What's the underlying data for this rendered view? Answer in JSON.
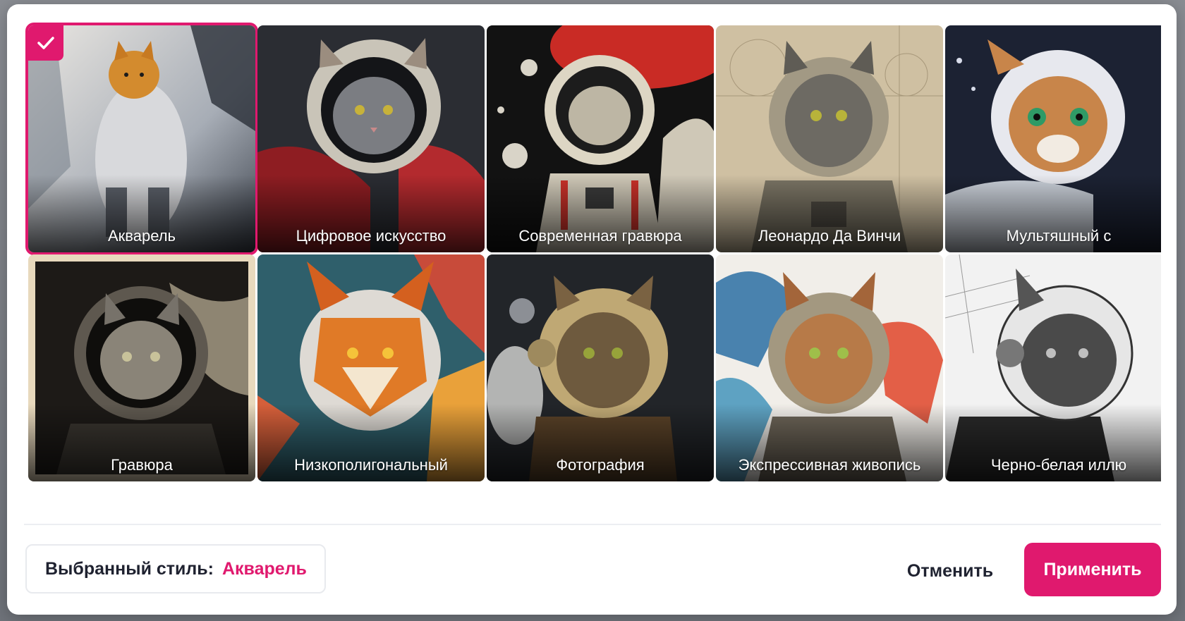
{
  "styles": [
    {
      "label": "Акварель"
    },
    {
      "label": "Цифровое искусство"
    },
    {
      "label": "Современная гравюра"
    },
    {
      "label": "Леонардо Да Винчи"
    },
    {
      "label": "Мультяшный с"
    },
    {
      "label": "Гравюра"
    },
    {
      "label": "Низкополигональный"
    },
    {
      "label": "Фотография"
    },
    {
      "label": "Экспрессивная живопись"
    },
    {
      "label": "Черно-белая иллю"
    }
  ],
  "selection": {
    "caption": "Выбранный стиль:",
    "value": "Акварель"
  },
  "actions": {
    "cancel": "Отменить",
    "apply": "Применить"
  },
  "colors": {
    "accent": "#e0196e",
    "text": "#1f2230"
  }
}
